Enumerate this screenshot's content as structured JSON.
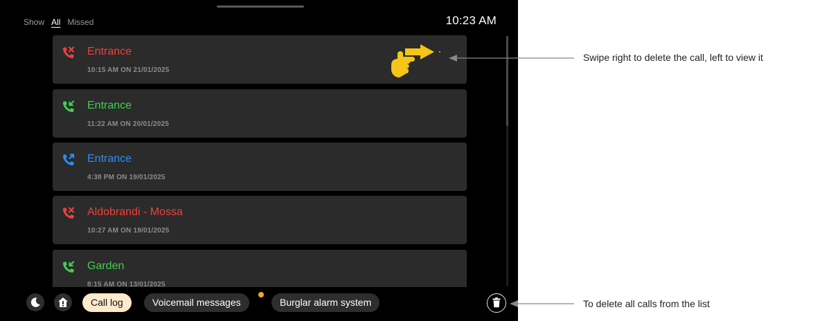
{
  "filter": {
    "label": "Show",
    "options": [
      "All",
      "Missed"
    ],
    "selected": "All"
  },
  "clock": "10:23 AM",
  "calls": [
    {
      "name": "Entrance",
      "time": "10:15 AM ON 21/01/2025",
      "status": "missed",
      "color": "#f0403a"
    },
    {
      "name": "Entrance",
      "time": "11:22 AM ON 20/01/2025",
      "status": "answered",
      "color": "#3ed14f"
    },
    {
      "name": "Entrance",
      "time": "4:38 PM ON 19/01/2025",
      "status": "outgoing",
      "color": "#2f8ef0"
    },
    {
      "name": "Aldobrandi - Mossa",
      "time": "10:27 AM ON 19/01/2025",
      "status": "missed",
      "color": "#f0403a"
    },
    {
      "name": "Garden",
      "time": "8:15 AM ON 13/01/2025",
      "status": "answered",
      "color": "#3ed14f"
    }
  ],
  "bottom_bar": {
    "buttons": [
      {
        "icon": "moon-icon"
      },
      {
        "icon": "home-alert-icon"
      }
    ],
    "tabs": [
      {
        "label": "Call log",
        "active": true
      },
      {
        "label": "Voicemail messages",
        "active": false,
        "has_notification": true
      },
      {
        "label": "Burglar alarm system",
        "active": false
      }
    ],
    "delete_all_icon": "trash-icon"
  },
  "annotations": {
    "swipe": "Swipe right to delete the call, left to view it",
    "delete_all": "To delete all calls from the list"
  },
  "colors": {
    "missed": "#f0403a",
    "answered": "#3ed14f",
    "outgoing": "#2f8ef0",
    "active_tab": "#fde9cc",
    "notification_dot": "#f5a623",
    "hand": "#f5c518"
  }
}
